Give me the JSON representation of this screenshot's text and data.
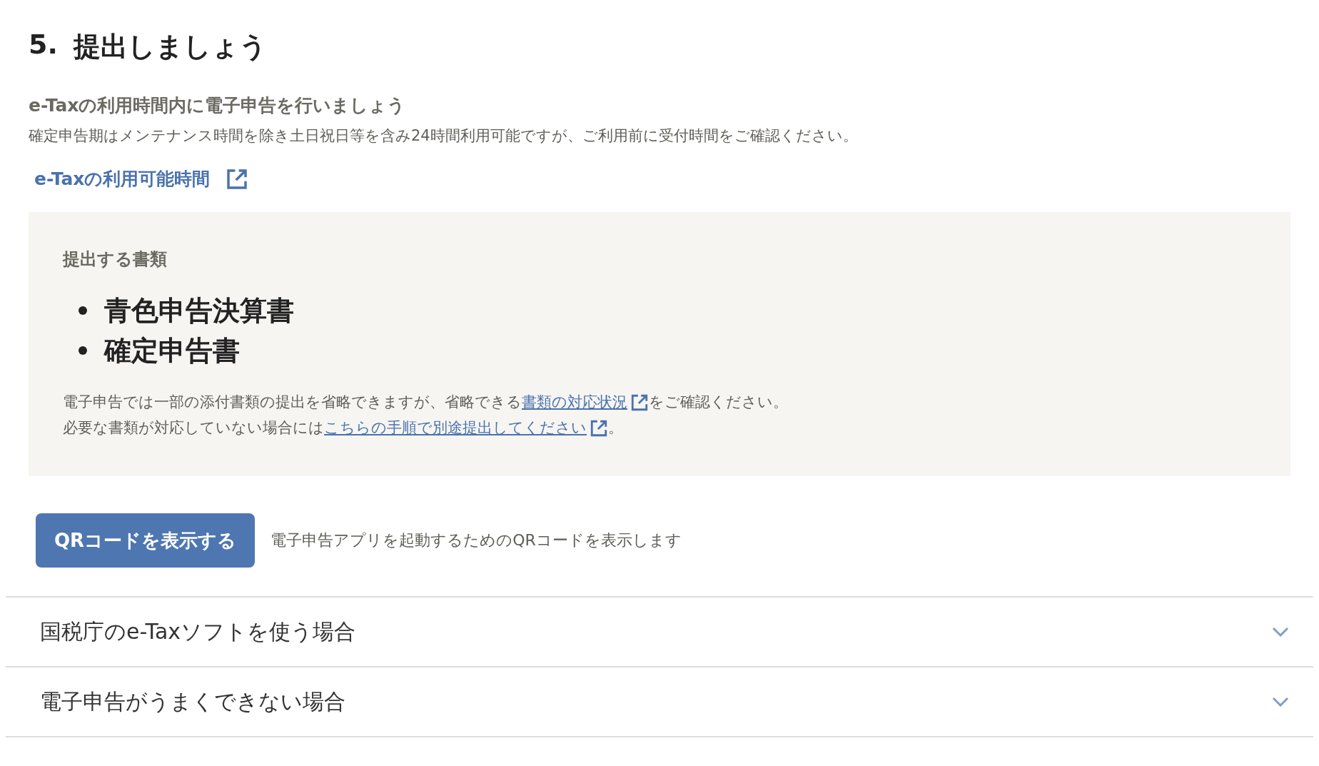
{
  "section": {
    "number": "5.",
    "title": "提出しましょう"
  },
  "intro": {
    "heading": "e-Taxの利用時間内に電子申告を行いましょう",
    "text": "確定申告期はメンテナンス時間を除き土日祝日等を含み24時間利用可能ですが、ご利用前に受付時間をご確認ください。",
    "link": "e-Taxの利用可能時間"
  },
  "documents": {
    "heading": "提出する書類",
    "items": [
      "青色申告決算書",
      "確定申告書"
    ],
    "notes": [
      [
        {
          "kind": "text",
          "text": "電子申告では一部の添付書類の提出を省略できますが、省略できる"
        },
        {
          "kind": "link",
          "text": "書類の対応状況"
        },
        {
          "kind": "text",
          "text": "をご確認ください。"
        }
      ],
      [
        {
          "kind": "text",
          "text": "必要な書類が対応していない場合には"
        },
        {
          "kind": "link",
          "text": "こちらの手順で別途提出してください"
        },
        {
          "kind": "text",
          "text": "。"
        }
      ]
    ]
  },
  "qr": {
    "button": "QRコードを表示する",
    "description": "電子申告アプリを起動するためのQRコードを表示します"
  },
  "accordions": [
    {
      "label": "国税庁のe-Taxソフトを使う場合",
      "expanded": false
    },
    {
      "label": "電子申告がうまくできない場合",
      "expanded": false
    }
  ]
}
